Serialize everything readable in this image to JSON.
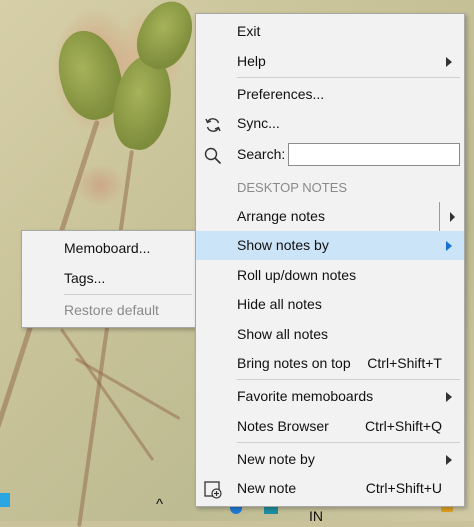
{
  "main_menu": {
    "exit": "Exit",
    "help": "Help",
    "preferences": "Preferences...",
    "sync": "Sync...",
    "search_label": "Search:",
    "search_value": "",
    "section_header": "DESKTOP NOTES",
    "arrange_notes": "Arrange notes",
    "show_notes_by": "Show notes by",
    "roll_up_down": "Roll up/down notes",
    "hide_all": "Hide all notes",
    "show_all": "Show all notes",
    "bring_on_top": "Bring notes on top",
    "bring_on_top_shortcut": "Ctrl+Shift+T",
    "favorite_memoboards": "Favorite memoboards",
    "notes_browser": "Notes Browser",
    "notes_browser_shortcut": "Ctrl+Shift+Q",
    "new_note_by": "New note by",
    "new_note": "New note",
    "new_note_shortcut": "Ctrl+Shift+U"
  },
  "sub_menu": {
    "memoboard": "Memoboard...",
    "tags": "Tags...",
    "restore_default": "Restore default"
  },
  "taskbar": {
    "chevron": "^",
    "language": "IN"
  },
  "colors": {
    "menu_bg": "#f2f2f2",
    "highlight": "#cce4f7",
    "disabled_text": "#8a8a8a"
  }
}
